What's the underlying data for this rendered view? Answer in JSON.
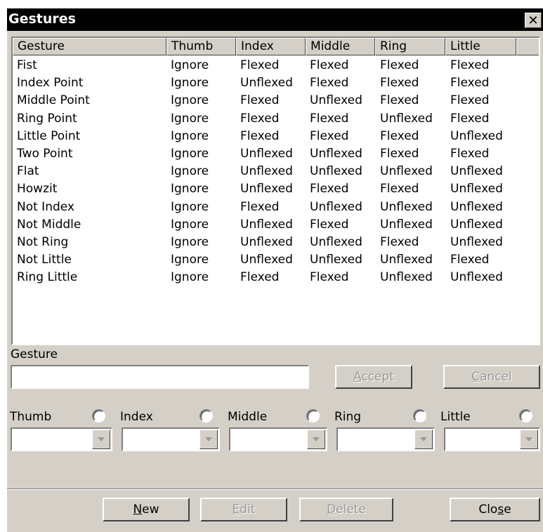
{
  "window": {
    "title": "Gestures",
    "close": "✕"
  },
  "list": {
    "columns": [
      "Gesture",
      "Thumb",
      "Index",
      "Middle",
      "Ring",
      "Little"
    ],
    "rows": [
      [
        "Fist",
        "Ignore",
        "Flexed",
        "Flexed",
        "Flexed",
        "Flexed"
      ],
      [
        "Index Point",
        "Ignore",
        "Unflexed",
        "Flexed",
        "Flexed",
        "Flexed"
      ],
      [
        "Middle Point",
        "Ignore",
        "Flexed",
        "Unflexed",
        "Flexed",
        "Flexed"
      ],
      [
        "Ring Point",
        "Ignore",
        "Flexed",
        "Flexed",
        "Unflexed",
        "Flexed"
      ],
      [
        "Little Point",
        "Ignore",
        "Flexed",
        "Flexed",
        "Flexed",
        "Unflexed"
      ],
      [
        "Two Point",
        "Ignore",
        "Unflexed",
        "Unflexed",
        "Flexed",
        "Flexed"
      ],
      [
        "Flat",
        "Ignore",
        "Unflexed",
        "Unflexed",
        "Unflexed",
        "Unflexed"
      ],
      [
        "Howzit",
        "Ignore",
        "Unflexed",
        "Flexed",
        "Flexed",
        "Unflexed"
      ],
      [
        "Not Index",
        "Ignore",
        "Flexed",
        "Unflexed",
        "Unflexed",
        "Unflexed"
      ],
      [
        "Not Middle",
        "Ignore",
        "Unflexed",
        "Flexed",
        "Unflexed",
        "Unflexed"
      ],
      [
        "Not Ring",
        "Ignore",
        "Unflexed",
        "Unflexed",
        "Flexed",
        "Unflexed"
      ],
      [
        "Not Little",
        "Ignore",
        "Unflexed",
        "Unflexed",
        "Unflexed",
        "Flexed"
      ],
      [
        "Ring Little",
        "Ignore",
        "Flexed",
        "Flexed",
        "Unflexed",
        "Unflexed"
      ]
    ]
  },
  "form": {
    "gesture_label": "Gesture",
    "gesture_value": "",
    "accept_pre": "",
    "accept_ul": "A",
    "accept_post": "ccept",
    "cancel_pre": "",
    "cancel_ul": "C",
    "cancel_post": "ancel",
    "fingers": [
      {
        "label": "Thumb",
        "value": ""
      },
      {
        "label": "Index",
        "value": ""
      },
      {
        "label": "Middle",
        "value": ""
      },
      {
        "label": "Ring",
        "value": ""
      },
      {
        "label": "Little",
        "value": ""
      }
    ]
  },
  "buttons": {
    "new_pre": "",
    "new_ul": "N",
    "new_post": "ew",
    "edit_pre": "",
    "edit_ul": "E",
    "edit_post": "dit",
    "delete_pre": "",
    "delete_ul": "D",
    "delete_post": "elete",
    "close_pre": "Clo",
    "close_ul": "s",
    "close_post": "e"
  }
}
